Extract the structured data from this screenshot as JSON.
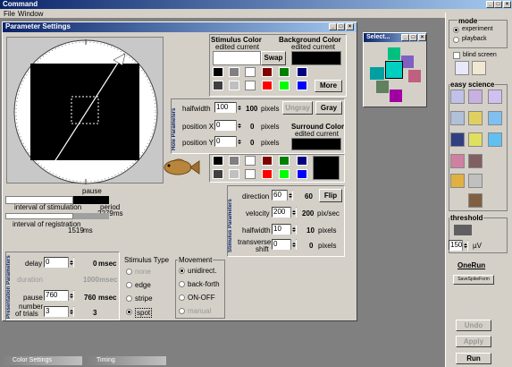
{
  "app": {
    "title": "Command",
    "menu": [
      "File",
      "Window"
    ]
  },
  "param_window": {
    "title": "Parameter Settings"
  },
  "stimulus_color": {
    "title": "Stimulus Color",
    "sub": "edited  current",
    "swap": "Swap"
  },
  "background_color": {
    "title": "Background Color",
    "sub": "edited  current"
  },
  "more": "More",
  "hole": {
    "label": "Hole Parameters",
    "rows": [
      {
        "label": "halfwidth",
        "value": "100",
        "display": "100",
        "unit": "pixels"
      },
      {
        "label": "position X",
        "value": "0",
        "display": "0",
        "unit": "pixels"
      },
      {
        "label": "position Y",
        "value": "0",
        "display": "0",
        "unit": "pixels"
      }
    ],
    "ungray": "Ungray",
    "gray": "Gray"
  },
  "surround_color": {
    "title": "Surround Color",
    "sub": "edited  current"
  },
  "timing": {
    "pause": "pause",
    "period": "period",
    "period_val": "2279",
    "period_unit": "ms",
    "stim": "interval of stimulation",
    "reg": "interval of registration",
    "reg_val": "1519",
    "reg_unit": "ms"
  },
  "stimulus_params": {
    "label": "Stimulus Parameters",
    "rows": [
      {
        "label": "direction",
        "value": "60",
        "display": "60",
        "unit": ""
      },
      {
        "label": "velocity",
        "value": "200",
        "display": "200",
        "unit": "pix/sec"
      },
      {
        "label": "halfwidth",
        "value": "10",
        "display": "10",
        "unit": "pixels"
      },
      {
        "label": "transverse",
        "label2": "shift",
        "value": "0",
        "display": "0",
        "unit": "pixels"
      }
    ],
    "flip": "Flip"
  },
  "presentation": {
    "label": "Presentation Parameters",
    "delay_label": "delay",
    "delay": "0",
    "delay_disp": "0",
    "delay_unit": "msec",
    "duration_label": "duration",
    "duration_disp": "1000",
    "duration_unit": "msec",
    "pause_label": "pause",
    "pause": "760",
    "pause_disp": "760",
    "pause_unit": "msec",
    "trials_label": "number",
    "trials_label2": "of trials",
    "trials": "3",
    "trials_disp": "3"
  },
  "stim_type": {
    "title": "Stimulus Type",
    "options": [
      "none",
      "edge",
      "stripe",
      "spot"
    ],
    "selected": "spot"
  },
  "movement": {
    "title": "Movement",
    "options": [
      "unidirect.",
      "back-forth",
      "ON-OFF",
      "manual"
    ],
    "selected": "unidirect."
  },
  "select_win": {
    "title": "Select..."
  },
  "side": {
    "mode_title": "mode",
    "modes": [
      "experiment",
      "playback"
    ],
    "mode_selected": "experiment",
    "blind": "blind screen",
    "easy": "easy science",
    "threshold": "threshold",
    "thr_value": "150",
    "thr_unit": "µV",
    "onerun": "OneRun",
    "savespike": "SaveSpikeForm",
    "undo": "Undo",
    "apply": "Apply",
    "run": "Run"
  },
  "taskbar": [
    {
      "title": "Color Settings"
    },
    {
      "title": "Timing"
    }
  ],
  "colors": {
    "title": "#0a246a",
    "face": "#d4d0c8"
  }
}
